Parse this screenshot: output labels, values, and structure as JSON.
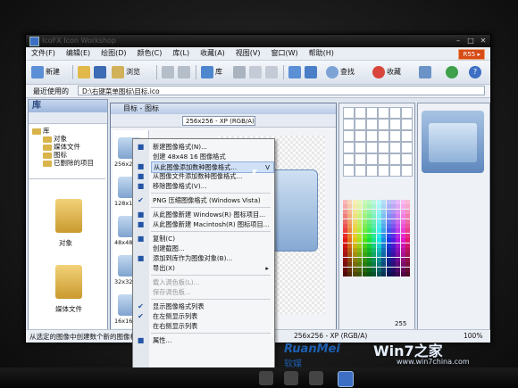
{
  "window": {
    "title": "IcoFX Icon Workshop",
    "pro_badge": "R55 ▸"
  },
  "menu": [
    "文件(F)",
    "编辑(E)",
    "绘图(D)",
    "颜色(C)",
    "库(L)",
    "收藏(A)",
    "视图(V)",
    "窗口(W)",
    "帮助(H)"
  ],
  "toolbar": {
    "new": "新建",
    "browse": "浏览",
    "library": "库",
    "find": "查找",
    "favorites": "收藏"
  },
  "address": {
    "label": "最近使用的",
    "value": "D:\\右键菜单图标\\目标.ico"
  },
  "library": {
    "title": "库",
    "tree": [
      "库",
      "对象",
      "媒体文件",
      "图标",
      "已删除的项目"
    ],
    "items": [
      "对象",
      "媒体文件"
    ]
  },
  "document": {
    "title": "目标 - 图标",
    "size_select": "256x256 - XP (RGB/A)",
    "thumb_labels": [
      "256x25",
      "128x12",
      "48x48",
      "32x32",
      "16x16"
    ]
  },
  "context_menu": [
    {
      "label": "新建图像格式(N)...",
      "icon": "new-format-icon",
      "state": "normal"
    },
    {
      "label": "创建 48x48 16 图像格式",
      "icon": "",
      "state": "normal"
    },
    {
      "label": "从此图像添加数种图像格式...",
      "icon": "add-formats-icon",
      "state": "highlighted",
      "shortcut": "V"
    },
    {
      "label": "从图像文件添加数种图像格式...",
      "icon": "file-formats-icon",
      "state": "normal"
    },
    {
      "label": "移除图像格式(V)...",
      "icon": "remove-format-icon",
      "state": "normal"
    },
    {
      "label": "sep"
    },
    {
      "label": "PNG 压缩图像格式 (Windows Vista)",
      "icon": "check-icon",
      "state": "normal"
    },
    {
      "label": "sep"
    },
    {
      "label": "从此图像新建 Windows(R) 图标项目...",
      "icon": "windows-icon",
      "state": "normal"
    },
    {
      "label": "从此图像新建 Macintosh(R) 图标项目...",
      "icon": "mac-icon",
      "state": "normal"
    },
    {
      "label": "sep"
    },
    {
      "label": "复制(C)",
      "icon": "copy-icon",
      "state": "normal"
    },
    {
      "label": "创建截图...",
      "icon": "",
      "state": "normal"
    },
    {
      "label": "添加到库作为图像对象(B)...",
      "icon": "library-add-icon",
      "state": "normal"
    },
    {
      "label": "导出(X)",
      "icon": "",
      "state": "normal",
      "submenu": true
    },
    {
      "label": "sep"
    },
    {
      "label": "载入调色板(L)...",
      "icon": "",
      "state": "disabled"
    },
    {
      "label": "保存调色板...",
      "icon": "",
      "state": "disabled"
    },
    {
      "label": "sep"
    },
    {
      "label": "显示图像格式列表",
      "icon": "check-icon",
      "state": "normal"
    },
    {
      "label": "在左侧显示列表",
      "icon": "check-icon",
      "state": "normal"
    },
    {
      "label": "在右侧显示列表",
      "icon": "",
      "state": "normal"
    },
    {
      "label": "sep"
    },
    {
      "label": "属性...",
      "icon": "properties-icon",
      "state": "normal"
    }
  ],
  "tools": {
    "value": "255"
  },
  "status": {
    "left": "从选定的图像中创建数个新的图像格式",
    "size": "256x256 - XP (RGB/A)",
    "kb": "Kb",
    "zoom": "100%"
  },
  "watermark": {
    "ruanmei": "RuanMei",
    "ruanmei_cn": "软媒",
    "win7": "Win7之家",
    "url": "www.win7china.com"
  },
  "colors": {
    "accent": "#3d6fc4",
    "highlight": "#cfe0f7"
  }
}
